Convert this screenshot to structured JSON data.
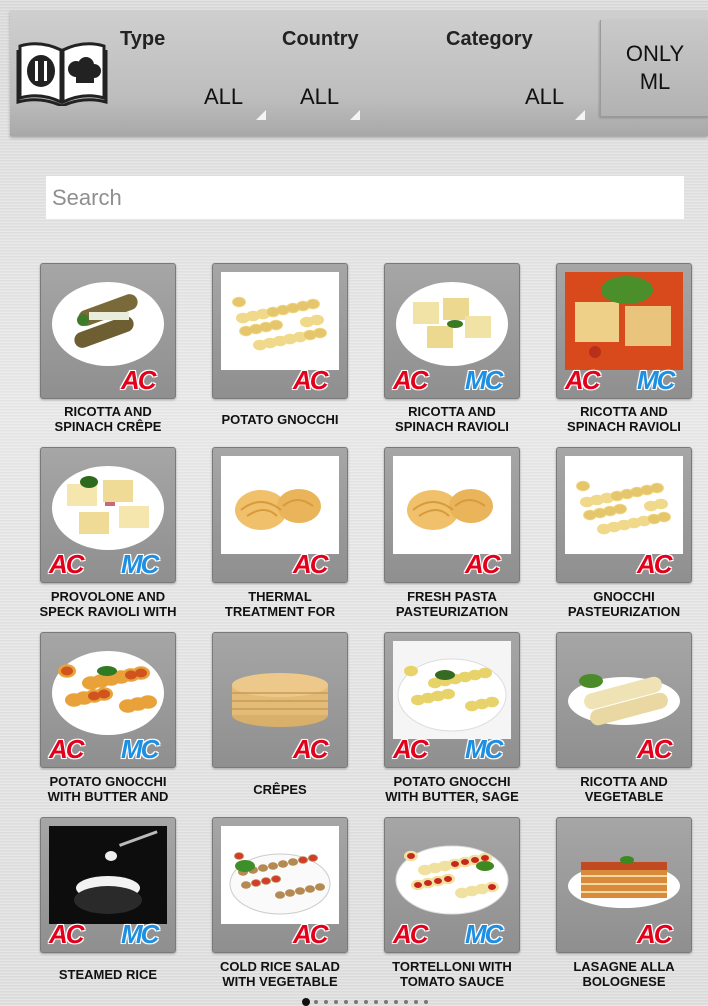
{
  "filters": {
    "type": {
      "label": "Type",
      "value": "ALL"
    },
    "country": {
      "label": "Country",
      "value": "ALL"
    },
    "category": {
      "label": "Category",
      "value": "ALL"
    },
    "only_ml": {
      "line1": "ONLY",
      "line2": "ML"
    }
  },
  "search": {
    "placeholder": "Search",
    "value": ""
  },
  "recipes": [
    {
      "title1": "RICOTTA AND",
      "title2": "SPINACH CRÊPE",
      "ac": true,
      "mc": false,
      "food": "crepe-rolls"
    },
    {
      "title1": "POTATO GNOCCHI",
      "title2": "",
      "ac": true,
      "mc": false,
      "food": "gnocchi"
    },
    {
      "title1": "RICOTTA AND",
      "title2": "SPINACH RAVIOLI",
      "ac": true,
      "mc": true,
      "food": "ravioli"
    },
    {
      "title1": "RICOTTA AND",
      "title2": "SPINACH RAVIOLI",
      "ac": true,
      "mc": true,
      "food": "ravioli-tomato"
    },
    {
      "title1": "PROVOLONE AND",
      "title2": "SPECK RAVIOLI WITH",
      "ac": true,
      "mc": true,
      "food": "ravioli-speck"
    },
    {
      "title1": "THERMAL",
      "title2": "TREATMENT FOR",
      "ac": true,
      "mc": false,
      "food": "tagliatelle"
    },
    {
      "title1": "FRESH PASTA",
      "title2": "PASTEURIZATION",
      "ac": true,
      "mc": false,
      "food": "tagliatelle"
    },
    {
      "title1": "GNOCCHI",
      "title2": "PASTEURIZATION",
      "ac": true,
      "mc": false,
      "food": "gnocchi"
    },
    {
      "title1": "POTATO GNOCCHI",
      "title2": "WITH BUTTER AND",
      "ac": true,
      "mc": true,
      "food": "gnocchi-tomato"
    },
    {
      "title1": "CRÊPES",
      "title2": "",
      "ac": true,
      "mc": false,
      "food": "crepes-stack"
    },
    {
      "title1": "POTATO GNOCCHI",
      "title2": "WITH BUTTER, SAGE",
      "ac": true,
      "mc": true,
      "food": "gnocchi-sage"
    },
    {
      "title1": "RICOTTA AND",
      "title2": "VEGETABLE",
      "ac": true,
      "mc": false,
      "food": "cannelloni"
    },
    {
      "title1": "STEAMED RICE",
      "title2": "",
      "ac": true,
      "mc": true,
      "food": "rice"
    },
    {
      "title1": "COLD RICE SALAD",
      "title2": "WITH VEGETABLE",
      "ac": true,
      "mc": false,
      "food": "rice-salad"
    },
    {
      "title1": "TORTELLONI WITH",
      "title2": "TOMATO SAUCE",
      "ac": true,
      "mc": true,
      "food": "tortelloni"
    },
    {
      "title1": "LASAGNE ALLA",
      "title2": "BOLOGNESE",
      "ac": true,
      "mc": false,
      "food": "lasagne"
    }
  ],
  "pager": {
    "pages": 13,
    "current": 1
  }
}
